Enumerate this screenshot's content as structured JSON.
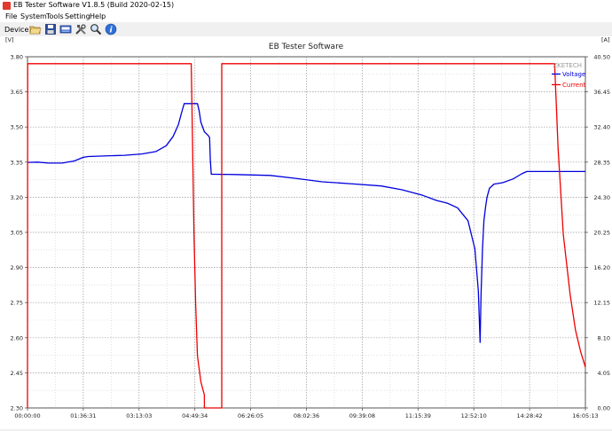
{
  "window": {
    "title": "EB Tester Software V1.8.5 (Build 2020-02-15)"
  },
  "menu": [
    "File",
    "System",
    "Tools",
    "Setting",
    "Help"
  ],
  "toolbar": {
    "device_label": "Device1",
    "icons": [
      "open-folder-icon",
      "save-icon",
      "meter-icon",
      "tools-icon",
      "search-icon",
      "info-icon"
    ]
  },
  "chart_data": {
    "type": "line",
    "title": "EB Tester Software",
    "watermark": "ZKETECH",
    "left_unit": "[V]",
    "right_unit": "[A]",
    "grid": true,
    "legend_position": "top-right",
    "y_left_ticks": [
      "3.80",
      "3.65",
      "3.50",
      "3.35",
      "3.20",
      "3.05",
      "2.90",
      "2.75",
      "2.60",
      "2.45",
      "2.30"
    ],
    "y_right_ticks": [
      "40.50",
      "36.45",
      "32.40",
      "28.35",
      "24.30",
      "20.25",
      "16.20",
      "12.15",
      "8.10",
      "4.05",
      "0.00"
    ],
    "x_ticks": [
      "00:00:00",
      "01:36:31",
      "03:13:03",
      "04:49:34",
      "06:26:05",
      "08:02:36",
      "09:39:08",
      "11:15:39",
      "12:52:10",
      "14:28:42",
      "16:05:13"
    ],
    "ylim_left": [
      2.3,
      3.8
    ],
    "ylim_right": [
      0,
      40.5
    ],
    "xlim_hours": [
      0,
      16.087
    ],
    "series": [
      {
        "name": "Voltage",
        "color": "#0000dd",
        "axis": "left",
        "x_hours": [
          0,
          0.3,
          0.6,
          1.0,
          1.35,
          1.6,
          1.75,
          2.2,
          2.8,
          3.3,
          3.7,
          4.0,
          4.2,
          4.35,
          4.45,
          4.52,
          4.56,
          4.6,
          4.7,
          4.9,
          4.95,
          5.0,
          5.1,
          5.22,
          5.25,
          5.27,
          5.3,
          5.4,
          6.0,
          7.0,
          7.7,
          8.5,
          9.3,
          10.2,
          10.8,
          11.4,
          11.8,
          12.1,
          12.4,
          12.7,
          12.9,
          13.0,
          13.05,
          13.08,
          13.12,
          13.16,
          13.21,
          13.25,
          13.32,
          13.45,
          13.7,
          14.0,
          14.25,
          14.4,
          14.6,
          15.0,
          15.5,
          16.087
        ],
        "values": [
          3.349,
          3.35,
          3.346,
          3.346,
          3.355,
          3.37,
          3.374,
          3.376,
          3.379,
          3.385,
          3.395,
          3.42,
          3.46,
          3.51,
          3.565,
          3.6,
          3.6,
          3.6,
          3.6,
          3.6,
          3.57,
          3.52,
          3.48,
          3.462,
          3.455,
          3.36,
          3.298,
          3.298,
          3.297,
          3.293,
          3.281,
          3.266,
          3.258,
          3.248,
          3.232,
          3.208,
          3.186,
          3.175,
          3.155,
          3.1,
          2.98,
          2.8,
          2.58,
          2.79,
          2.98,
          3.1,
          3.16,
          3.2,
          3.238,
          3.256,
          3.262,
          3.278,
          3.3,
          3.31,
          3.31,
          3.31,
          3.31,
          3.31
        ]
      },
      {
        "name": "Current",
        "color": "#ee0000",
        "axis": "right",
        "x_hours": [
          0,
          0.005,
          4.72,
          4.76,
          4.8,
          4.85,
          4.9,
          5.0,
          5.1,
          5.1,
          5.12,
          5.25,
          5.6,
          5.6,
          5.62,
          15.2,
          15.3,
          15.45,
          15.65,
          15.8,
          15.95,
          16.087
        ],
        "values": [
          0,
          39.7,
          39.7,
          30.5,
          20.0,
          12.0,
          6.0,
          3.0,
          1.5,
          0,
          0,
          0,
          0,
          39.7,
          39.7,
          39.7,
          30.0,
          20.0,
          13.0,
          9.0,
          6.5,
          4.7
        ]
      }
    ]
  }
}
